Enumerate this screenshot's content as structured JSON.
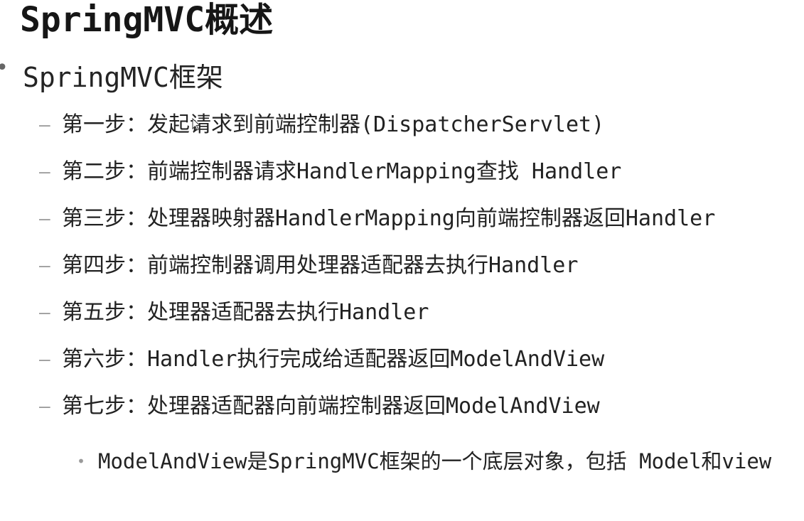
{
  "slide": {
    "title": "SpringMVC概述",
    "level1": {
      "bullet": "•",
      "text": "SpringMVC框架"
    },
    "steps": [
      {
        "dash": "–",
        "text": "第一步：发起请求到前端控制器(DispatcherServlet)"
      },
      {
        "dash": "–",
        "text": "第二步：前端控制器请求HandlerMapping查找 Handler"
      },
      {
        "dash": "–",
        "text": "第三步：处理器映射器HandlerMapping向前端控制器返回Handler"
      },
      {
        "dash": "–",
        "text": "第四步：前端控制器调用处理器适配器去执行Handler"
      },
      {
        "dash": "–",
        "text": "第五步：处理器适配器去执行Handler"
      },
      {
        "dash": "–",
        "text": "第六步：Handler执行完成给适配器返回ModelAndView"
      },
      {
        "dash": "–",
        "text": "第七步：处理器适配器向前端控制器返回ModelAndView"
      }
    ],
    "sub_bullet": {
      "dot": "•",
      "text": "ModelAndView是SpringMVC框架的一个底层对象，包括 Model和view"
    }
  }
}
